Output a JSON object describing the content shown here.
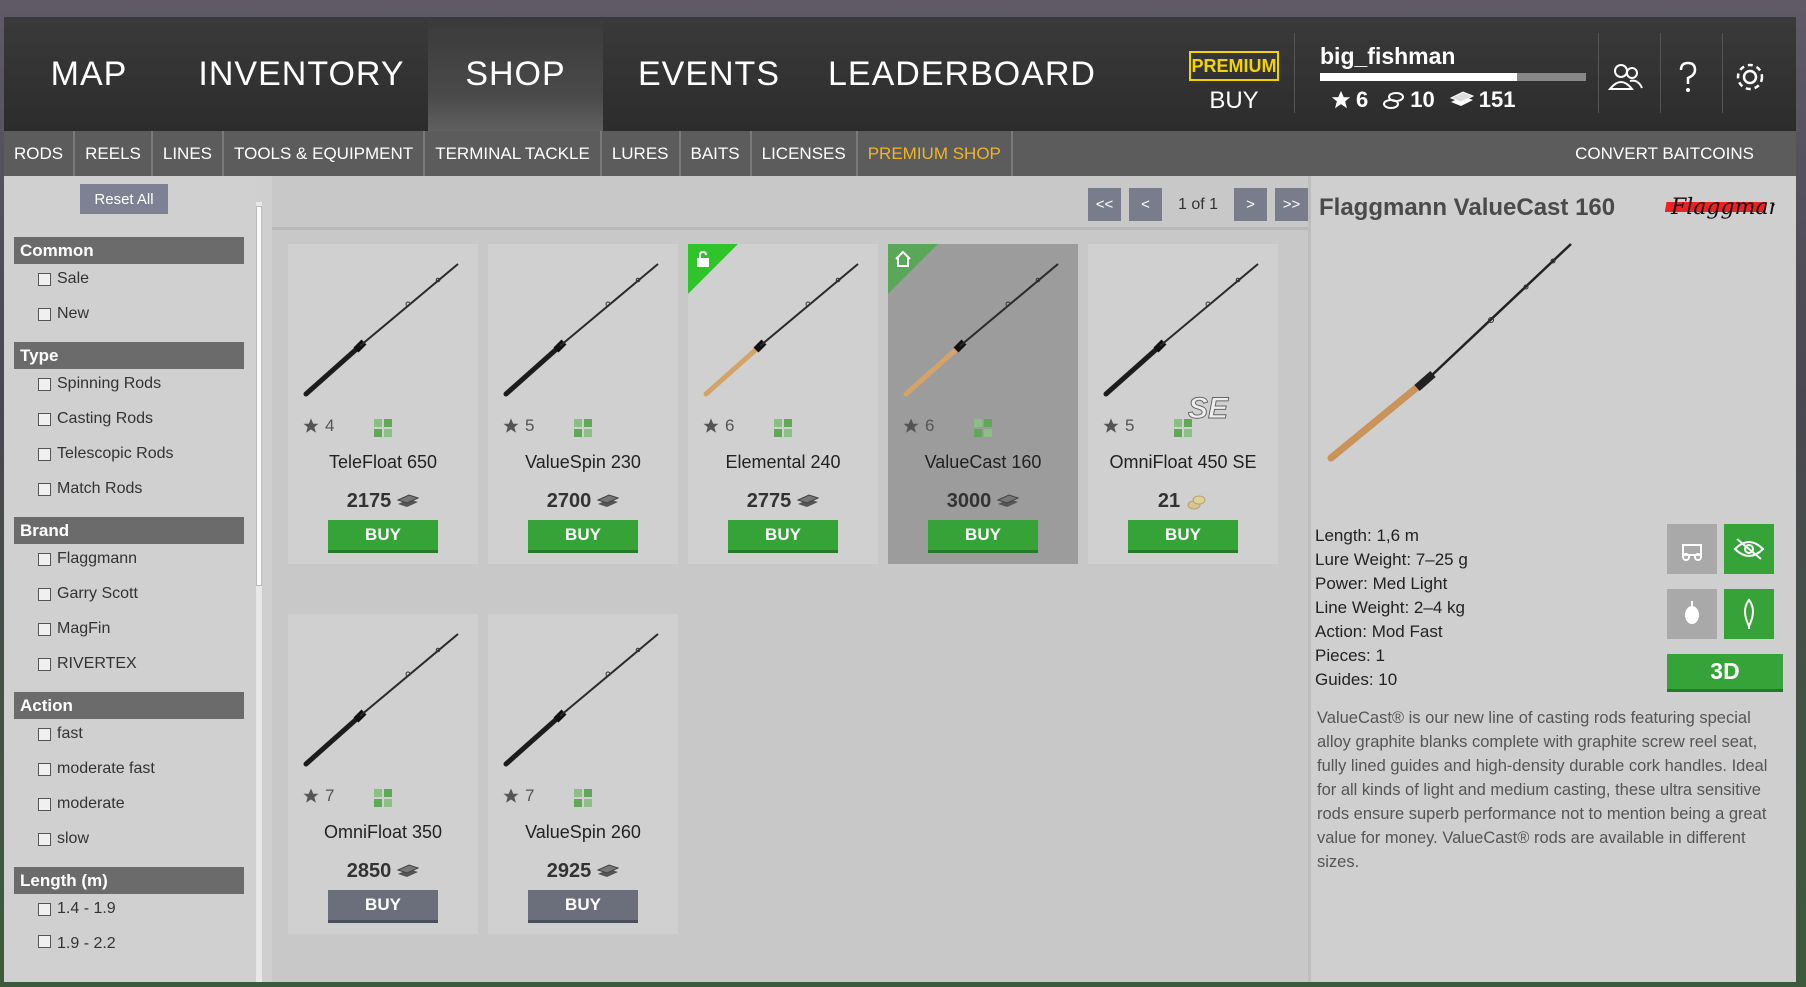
{
  "nav": {
    "tabs": [
      {
        "label": "MAP"
      },
      {
        "label": "INVENTORY"
      },
      {
        "label": "SHOP"
      },
      {
        "label": "EVENTS"
      },
      {
        "label": "LEADERBOARD"
      }
    ],
    "active": "SHOP",
    "premium_badge": "PREMIUM",
    "premium_buy": "BUY"
  },
  "player": {
    "username": "big_fishman",
    "xp_progress": 0.74,
    "level": "6",
    "baitcoins": "10",
    "credits": "151"
  },
  "subnav": {
    "tabs": [
      "RODS",
      "REELS",
      "LINES",
      "TOOLS & EQUIPMENT",
      "TERMINAL TACKLE",
      "LURES",
      "BAITS",
      "LICENSES",
      "PREMIUM SHOP"
    ],
    "convert": "CONVERT BAITCOINS"
  },
  "filters": {
    "reset": "Reset All",
    "groups": [
      {
        "title": "Common",
        "items": [
          "Sale",
          "New"
        ]
      },
      {
        "title": "Type",
        "items": [
          "Spinning Rods",
          "Casting Rods",
          "Telescopic Rods",
          "Match Rods"
        ]
      },
      {
        "title": "Brand",
        "items": [
          "Flaggmann",
          "Garry Scott",
          "MagFin",
          "RIVERTEX"
        ]
      },
      {
        "title": "Action",
        "items": [
          "fast",
          "moderate fast",
          "moderate",
          "slow"
        ]
      },
      {
        "title": "Length (m)",
        "items": [
          "1.4 - 1.9",
          "1.9 - 2.2"
        ]
      }
    ]
  },
  "pager": {
    "first": "<<",
    "prev": "<",
    "label": "1 of 1",
    "next": ">",
    "last": ">>"
  },
  "products": [
    {
      "name": "TeleFloat 650",
      "rating": "4",
      "price": "2175",
      "currency": "credits",
      "buy": "BUY",
      "handle": "dark",
      "badge": ""
    },
    {
      "name": "ValueSpin 230",
      "rating": "5",
      "price": "2700",
      "currency": "credits",
      "buy": "BUY",
      "handle": "dark",
      "badge": ""
    },
    {
      "name": "Elemental 240",
      "rating": "6",
      "price": "2775",
      "currency": "credits",
      "buy": "BUY",
      "handle": "cork",
      "badge": "unlock"
    },
    {
      "name": "ValueCast 160",
      "rating": "6",
      "price": "3000",
      "currency": "credits",
      "buy": "BUY",
      "handle": "cork",
      "badge": "home",
      "selected": true
    },
    {
      "name": "OmniFloat 450 SE",
      "rating": "5",
      "price": "21",
      "currency": "baitcoins",
      "buy": "BUY",
      "handle": "dark",
      "badge": "",
      "se": "SE"
    },
    {
      "name": "OmniFloat 350",
      "rating": "7",
      "price": "2850",
      "currency": "credits",
      "buy": "BUY",
      "handle": "dark",
      "badge": "",
      "locked": true
    },
    {
      "name": "ValueSpin 260",
      "rating": "7",
      "price": "2925",
      "currency": "credits",
      "buy": "BUY",
      "handle": "dark",
      "badge": "",
      "locked": true
    }
  ],
  "detail": {
    "title": "Flaggmann ValueCast 160",
    "brand_logo": "Flaggmann",
    "specs": [
      "Length: 1,6 m",
      "Lure Weight: 7–25 g",
      "Power: Med Light",
      "Line Weight: 2–4 kg",
      "Action: Mod Fast",
      "Pieces: 1",
      "Guides: 10"
    ],
    "btn_3d": "3D",
    "description": "ValueCast® is our new line of casting rods featuring special alloy graphite blanks complete with graphite screw reel seat, fully lined guides and high-density durable cork handles. Ideal for all kinds of light and medium casting, these ultra sensitive rods ensure superb performance not to mention being a great value for money. ValueCast® rods are available in different sizes."
  },
  "colors": {
    "accent_green": "#35a338",
    "premium_yellow": "#f5d300",
    "premium_tab": "#f0b429"
  }
}
